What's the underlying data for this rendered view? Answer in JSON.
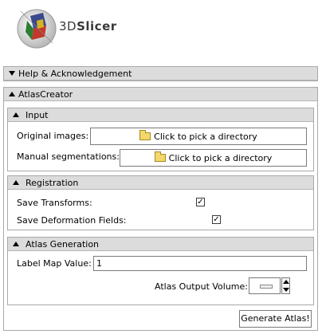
{
  "app": {
    "logo_icon": "slicer-3d-logo",
    "name_prefix": "3D",
    "name_bold": "Slicer"
  },
  "help": {
    "title": "Help & Acknowledgement",
    "state": "collapsed"
  },
  "atlas_creator": {
    "title": "AtlasCreator",
    "input": {
      "title": "Input",
      "original_images_label": "Original images:",
      "original_images_button": "Click to pick a directory",
      "manual_segmentations_label": "Manual segmentations:",
      "manual_segmentations_button": "Click to pick a directory"
    },
    "registration": {
      "title": "Registration",
      "save_transforms_label": "Save Transforms:",
      "save_transforms_checked": true,
      "save_deformation_label": "Save Deformation Fields:",
      "save_deformation_checked": true
    },
    "atlas_generation": {
      "title": "Atlas Generation",
      "label_map_value_label": "Label Map Value:",
      "label_map_value": "1",
      "atlas_output_volume_label": "Atlas Output Volume:"
    },
    "generate_button": "Generate Atlas!"
  },
  "colors": {
    "header_bg": "#dcdcdc",
    "border": "#a9a9a9",
    "folder": "#f3d76a"
  }
}
